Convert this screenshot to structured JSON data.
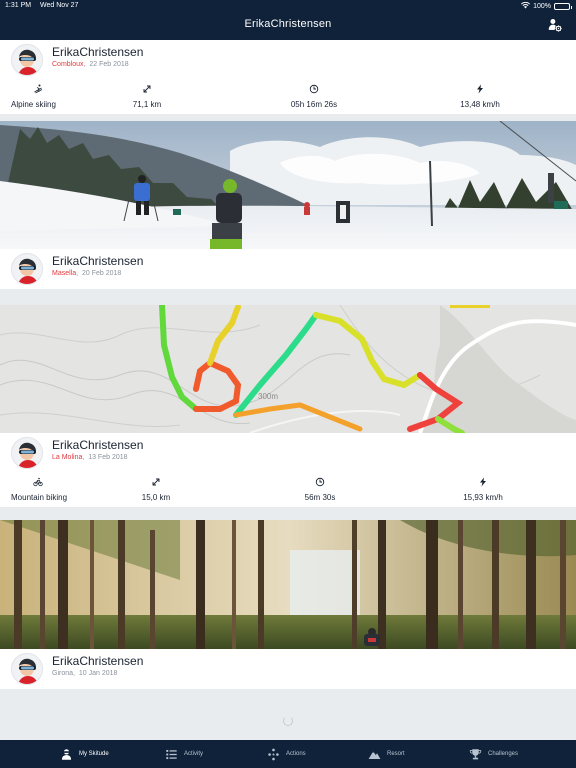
{
  "status_bar": {
    "time": "1:31 PM",
    "date": "Wed Nov 27",
    "battery": "100%"
  },
  "header": {
    "title": "ErikaChristensen"
  },
  "feed": [
    {
      "user": "ErikaChristensen",
      "location": "Combloux",
      "date": "22 Feb 2018",
      "stats": {
        "activity": "Alpine skiing",
        "distance": "71,1 km",
        "duration": "05h 16m 26s",
        "speed": "13,48 km/h"
      }
    },
    {
      "user": "ErikaChristensen",
      "location": "Masella",
      "date": "20 Feb 2018"
    },
    {
      "user": "ErikaChristensen",
      "location": "La Molina",
      "date": "13 Feb 2018",
      "stats": {
        "activity": "Mountain biking",
        "distance": "15,0 km",
        "duration": "56m 30s",
        "speed": "15,93 km/h"
      }
    },
    {
      "user": "ErikaChristensen",
      "location": "Girona",
      "date": "10 Jan 2018"
    }
  ],
  "map_scale_label": "300m",
  "tabs": [
    {
      "label": "My Skitude",
      "icon": "profile-icon",
      "active": true
    },
    {
      "label": "Activity",
      "icon": "list-icon",
      "active": false
    },
    {
      "label": "Actions",
      "icon": "dots-icon",
      "active": false
    },
    {
      "label": "Resort",
      "icon": "mountain-icon",
      "active": false
    },
    {
      "label": "Challenges",
      "icon": "trophy-icon",
      "active": false
    }
  ],
  "colors": {
    "nav_bg": "#0f2239",
    "location_red": "#e03a3e",
    "feed_bg": "#e9ecef"
  }
}
